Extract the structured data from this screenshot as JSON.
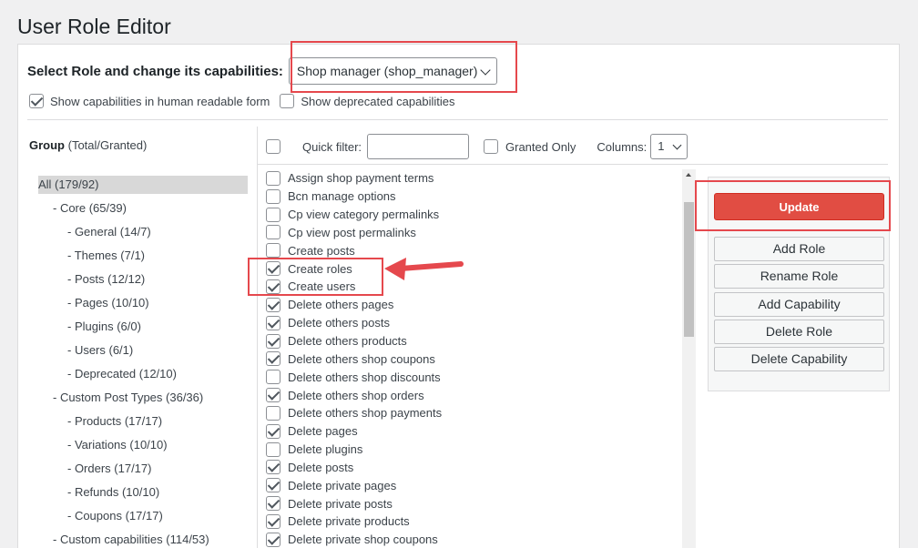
{
  "page": {
    "title": "User Role Editor"
  },
  "role_selector": {
    "label": "Select Role and change its capabilities:",
    "selected": "Shop manager (shop_manager)"
  },
  "options": [
    {
      "label": "Show capabilities in human readable form",
      "checked": true
    },
    {
      "label": "Show deprecated capabilities",
      "checked": false
    }
  ],
  "groups": {
    "header_bold": "Group",
    "header_rest": " (Total/Granted)",
    "items": [
      "All (179/92)",
      "- Core (65/39)",
      "- General (14/7)",
      "- Themes (7/1)",
      "- Posts (12/12)",
      "- Pages (10/10)",
      "- Plugins (6/0)",
      "- Users (6/1)",
      "- Deprecated (12/10)",
      "- Custom Post Types (36/36)",
      "- Products (17/17)",
      "- Variations (10/10)",
      "- Orders (17/17)",
      "- Refunds (10/10)",
      "- Coupons (17/17)",
      "- Custom capabilities (114/53)"
    ]
  },
  "filter_bar": {
    "quick_filter_label": "Quick filter:",
    "quick_filter_value": "",
    "granted_only_label": "Granted Only",
    "columns_label": "Columns:",
    "columns_value": "1"
  },
  "capabilities": [
    {
      "label": "Assign shop payment terms",
      "checked": false
    },
    {
      "label": "Bcn manage options",
      "checked": false
    },
    {
      "label": "Cp view category permalinks",
      "checked": false
    },
    {
      "label": "Cp view post permalinks",
      "checked": false
    },
    {
      "label": "Create posts",
      "checked": false
    },
    {
      "label": "Create roles",
      "checked": true
    },
    {
      "label": "Create users",
      "checked": true
    },
    {
      "label": "Delete others pages",
      "checked": true
    },
    {
      "label": "Delete others posts",
      "checked": true
    },
    {
      "label": "Delete others products",
      "checked": true
    },
    {
      "label": "Delete others shop coupons",
      "checked": true
    },
    {
      "label": "Delete others shop discounts",
      "checked": false
    },
    {
      "label": "Delete others shop orders",
      "checked": true
    },
    {
      "label": "Delete others shop payments",
      "checked": false
    },
    {
      "label": "Delete pages",
      "checked": true
    },
    {
      "label": "Delete plugins",
      "checked": false
    },
    {
      "label": "Delete posts",
      "checked": true
    },
    {
      "label": "Delete private pages",
      "checked": true
    },
    {
      "label": "Delete private posts",
      "checked": true
    },
    {
      "label": "Delete private products",
      "checked": true
    },
    {
      "label": "Delete private shop coupons",
      "checked": true
    }
  ],
  "actions": {
    "update": "Update",
    "add_role": "Add Role",
    "rename_role": "Rename Role",
    "add_capability": "Add Capability",
    "delete_role": "Delete Role",
    "delete_capability": "Delete Capability"
  },
  "colors": {
    "highlight": "#e5484d",
    "update_button": "#e14d43"
  }
}
